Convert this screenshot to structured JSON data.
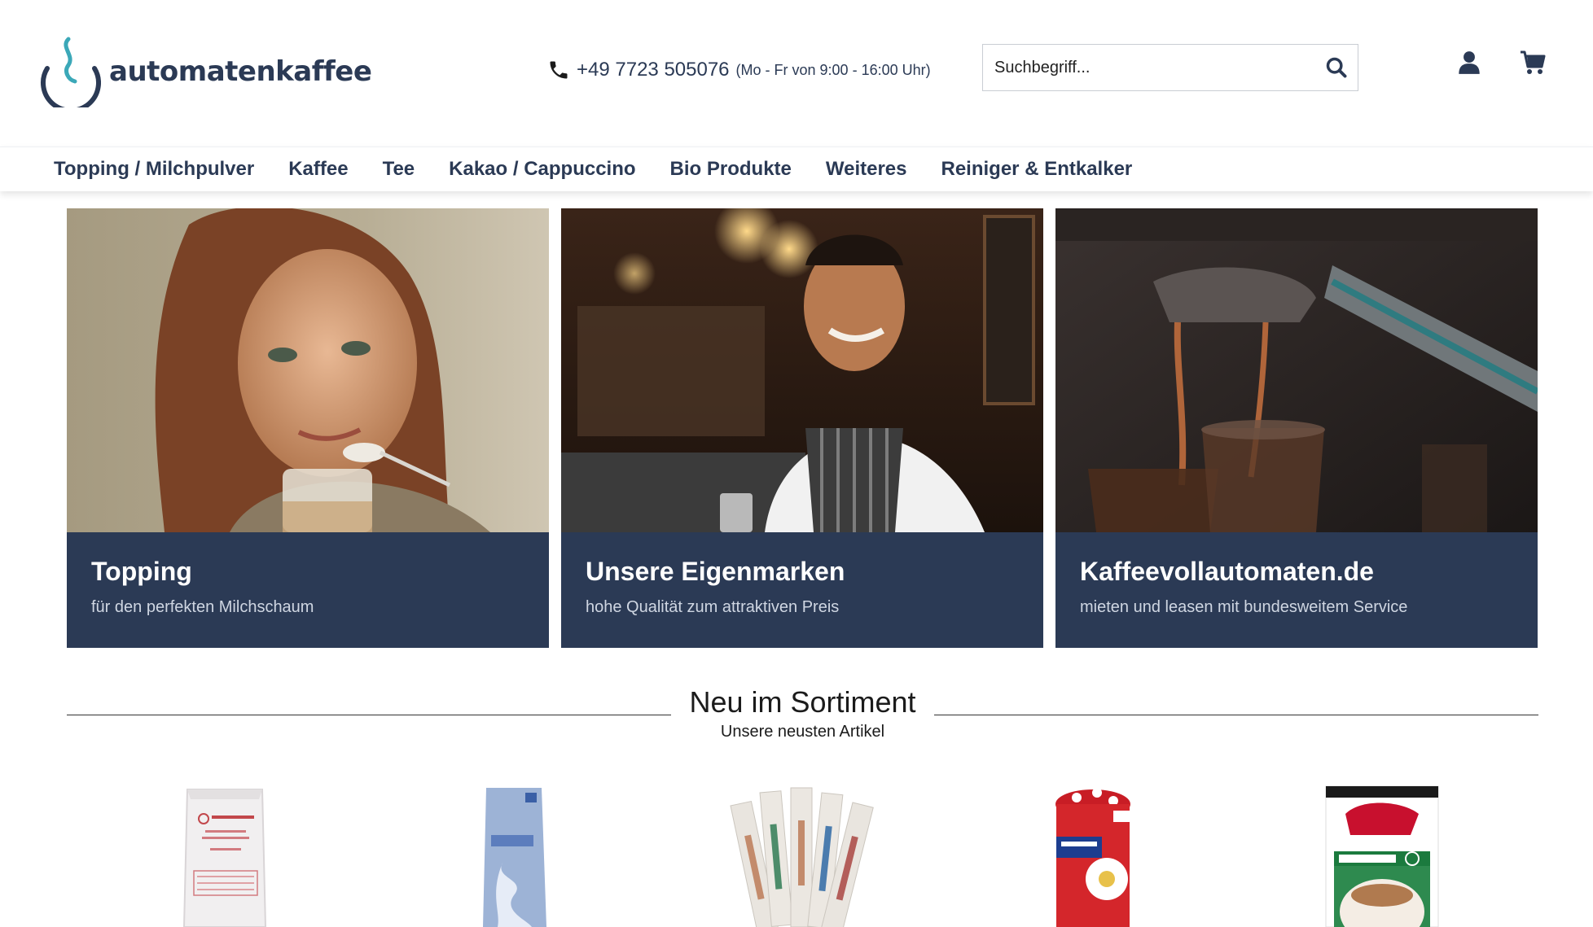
{
  "header": {
    "logo_text": "automatenkaffee",
    "phone_number": "+49 7723 505076",
    "phone_hours": "(Mo - Fr von 9:00 - 16:00 Uhr)",
    "search_placeholder": "Suchbegriff...",
    "icons": [
      "phone-icon",
      "search-icon",
      "account-icon",
      "cart-icon"
    ]
  },
  "nav": {
    "items": [
      "Topping / Milchpulver",
      "Kaffee",
      "Tee",
      "Kakao / Cappuccino",
      "Bio Produkte",
      "Weiteres",
      "Reiniger & Entkalker"
    ]
  },
  "teasers": [
    {
      "title": "Topping",
      "subtitle": "für den perfekten Milchschaum"
    },
    {
      "title": "Unsere Eigenmarken",
      "subtitle": "hohe Qualität zum attraktiven Preis"
    },
    {
      "title": "Kaffeevollautomaten.de",
      "subtitle": "mieten und leasen mit bundesweitem Service"
    }
  ],
  "section": {
    "title": "Neu im Sortiment",
    "subtitle": "Unsere neusten Artikel"
  },
  "products": [
    {
      "name": "cappuccino-topping-bag"
    },
    {
      "name": "plnt-bag"
    },
    {
      "name": "sugar-sticks"
    },
    {
      "name": "munz-tin"
    },
    {
      "name": "regilait-topping"
    }
  ],
  "colors": {
    "brand_dark": "#2b3a55",
    "logo_accent": "#3ba8b8",
    "card_subtitle": "#cfd6e2"
  }
}
